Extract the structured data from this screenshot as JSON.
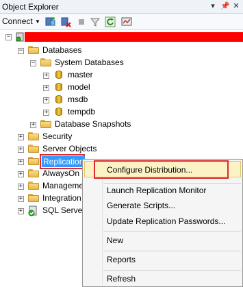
{
  "window": {
    "title": "Object Explorer",
    "header_icons": [
      "dropdown-icon",
      "pin-icon",
      "close-icon"
    ]
  },
  "toolbar": {
    "connect_label": "Connect",
    "buttons": [
      "connect-server-icon",
      "disconnect-icon",
      "stop-icon",
      "filter-icon",
      "refresh-icon",
      "activity-monitor-icon"
    ]
  },
  "tree": {
    "server_name": "",
    "nodes": {
      "databases": "Databases",
      "system_databases": "System Databases",
      "master": "master",
      "model": "model",
      "msdb": "msdb",
      "tempdb": "tempdb",
      "snapshots": "Database Snapshots",
      "security": "Security",
      "server_objects": "Server Objects",
      "replication": "Replication",
      "alwayson": "AlwaysOn H",
      "management": "Manageme",
      "integration": "Integration",
      "sql_agent": "SQL Server"
    }
  },
  "context_menu": {
    "configure_distribution": "Configure Distribution...",
    "launch_monitor": "Launch Replication Monitor",
    "generate_scripts": "Generate Scripts...",
    "update_passwords": "Update Replication Passwords...",
    "new": "New",
    "reports": "Reports",
    "refresh": "Refresh"
  },
  "colors": {
    "redaction": "#ff0000",
    "highlight_border": "#e0282c",
    "selection_bg": "#3399ff",
    "hover_bg": "#fbf3c6"
  }
}
